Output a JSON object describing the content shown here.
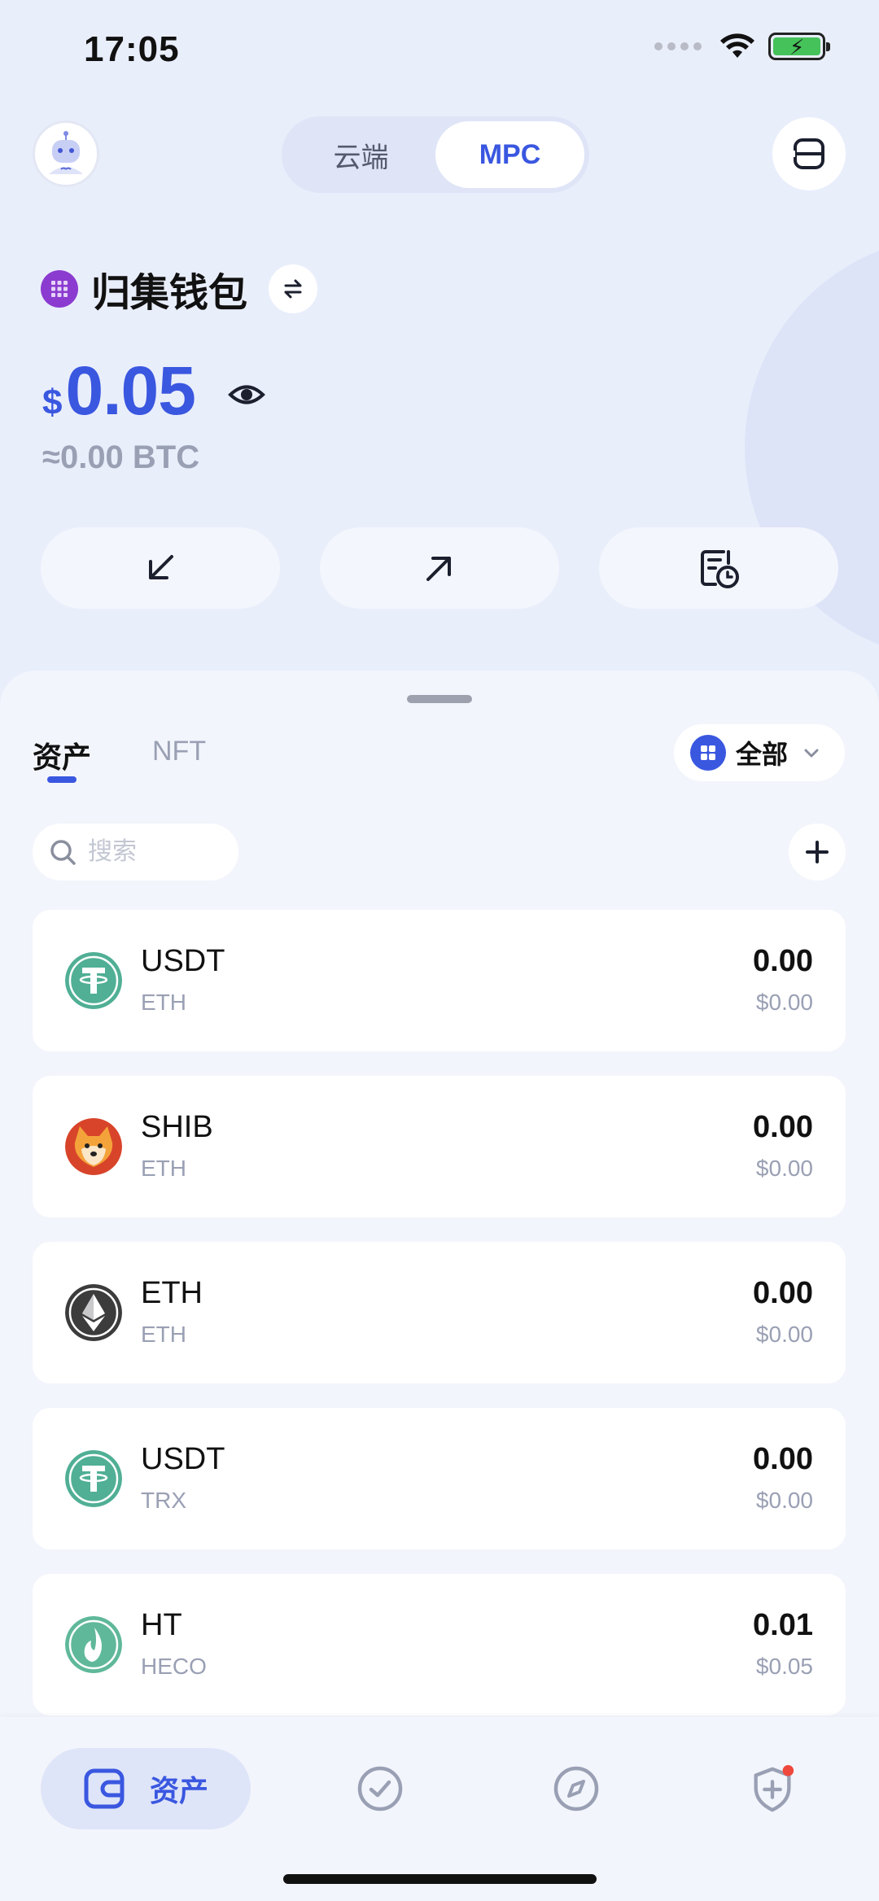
{
  "status_bar": {
    "time": "17:05"
  },
  "header": {
    "segments": [
      {
        "label": "云端",
        "active": false
      },
      {
        "label": "MPC",
        "active": true
      }
    ]
  },
  "wallet": {
    "name": "归集钱包",
    "currency_symbol": "$",
    "balance": "0.05",
    "btc_equivalent": "≈0.00 BTC"
  },
  "actions": [
    {
      "icon": "receive-arrow-icon"
    },
    {
      "icon": "send-arrow-icon"
    },
    {
      "icon": "history-icon"
    }
  ],
  "tabs": {
    "assets": "资产",
    "nft": "NFT"
  },
  "filter": {
    "label": "全部"
  },
  "search": {
    "placeholder": "搜索"
  },
  "tokens": [
    {
      "symbol": "USDT",
      "chain": "ETH",
      "amount": "0.00",
      "usd": "$0.00",
      "icon": "usdt-icon",
      "color": "#50af95"
    },
    {
      "symbol": "SHIB",
      "chain": "ETH",
      "amount": "0.00",
      "usd": "$0.00",
      "icon": "shib-icon",
      "color": "#e4621b"
    },
    {
      "symbol": "ETH",
      "chain": "ETH",
      "amount": "0.00",
      "usd": "$0.00",
      "icon": "eth-icon",
      "color": "#3c3c3d"
    },
    {
      "symbol": "USDT",
      "chain": "TRX",
      "amount": "0.00",
      "usd": "$0.00",
      "icon": "usdt-icon",
      "color": "#50af95"
    },
    {
      "symbol": "HT",
      "chain": "HECO",
      "amount": "0.01",
      "usd": "$0.05",
      "icon": "ht-icon",
      "color": "#5fb89a"
    }
  ],
  "bottom_nav": {
    "assets_label": "资产"
  },
  "colors": {
    "accent": "#3a57e0",
    "background": "#eef1fb",
    "muted": "#9aa0b4"
  }
}
